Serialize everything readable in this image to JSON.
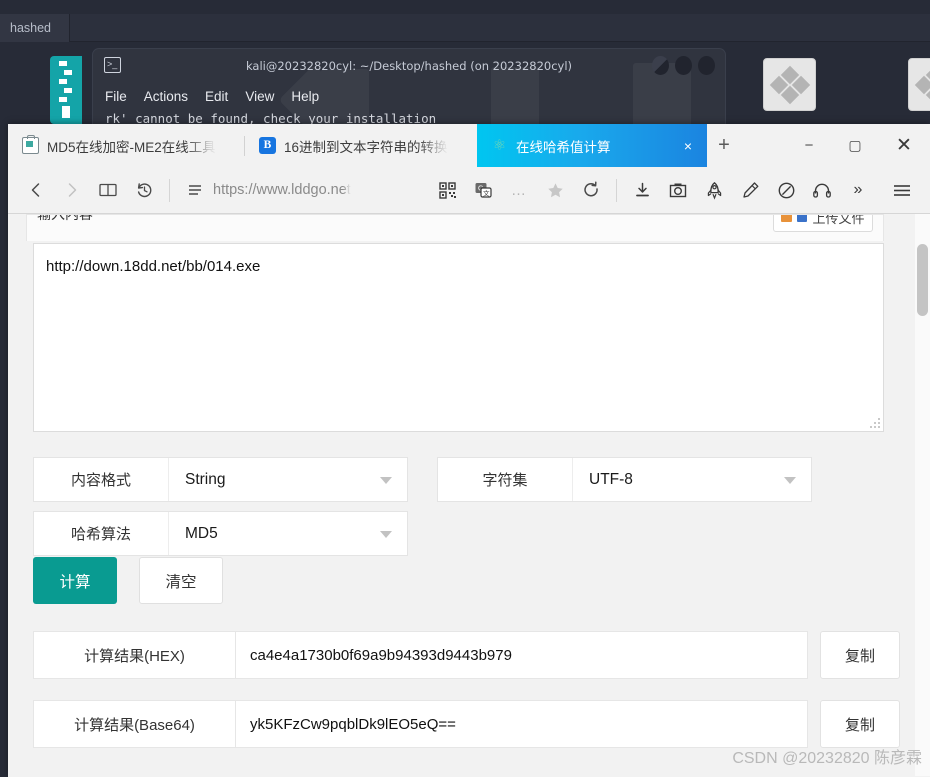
{
  "desktop": {
    "taskbar_tab": "hashed",
    "terminal": {
      "title": "kali@20232820cyl: ~/Desktop/hashed (on 20232820cyl)",
      "menu": [
        "File",
        "Actions",
        "Edit",
        "View",
        "Help"
      ],
      "output_line": "rk' cannot be found, check your installation"
    },
    "icons": [
      "desktop-icon-1",
      "desktop-icon-2"
    ]
  },
  "browser": {
    "tabs": [
      {
        "label": "MD5在线加密-ME2在线工具",
        "favicon": "md5-tool-icon",
        "active": false
      },
      {
        "label": "16进制到文本字符串的转换",
        "favicon": "b-letter-icon",
        "active": false
      },
      {
        "label": "在线哈希值计算",
        "favicon": "hash-network-icon",
        "active": true,
        "close": "×"
      }
    ],
    "new_tab_label": "+",
    "window_controls": {
      "minimize": "−",
      "maximize": "▢",
      "close": "✕"
    },
    "toolbar": {
      "back": "‹",
      "forward": "›",
      "reading_list": "book-icon",
      "history": "history-icon",
      "menu_lines": "list-icon",
      "url": "https://www.lddgo.net",
      "url_highlight": "lddgo.net",
      "qrcode": "qrcode-icon",
      "translate": "translate-icon",
      "more_dots": "…",
      "bookmark": "star-icon",
      "reload": "reload-icon",
      "download": "download-icon",
      "screenshot": "camera-icon",
      "speedup": "rocket-icon",
      "shield": "ink-icon",
      "compass": "compass-icon",
      "headphones": "headphones-icon",
      "overflow": "»",
      "hamburger": "hamburger-icon"
    }
  },
  "page": {
    "clipped_header_label": "输入内容",
    "upload_button": "上传文件",
    "textarea_value": "http://down.18dd.net/bb/014.exe",
    "fields": [
      {
        "label": "内容格式",
        "value": "String"
      },
      {
        "label": "字符集",
        "value": "UTF-8"
      },
      {
        "label": "哈希算法",
        "value": "MD5"
      }
    ],
    "buttons": {
      "calculate": "计算",
      "clear": "清空"
    },
    "results": [
      {
        "label": "计算结果(HEX)",
        "value": "ca4e4a1730b0f69a9b94393d9443b979",
        "copy": "复制"
      },
      {
        "label": "计算结果(Base64)",
        "value": "yk5KFzCw9pqblDk9lEO5eQ==",
        "copy": "复制"
      }
    ],
    "watermark": "CSDN @20232820 陈彦霖"
  },
  "colors": {
    "accent_teal": "#099b91",
    "active_tab_gradient_start": "#00c6f0",
    "active_tab_gradient_end": "#1b84e0",
    "desktop_bg": "#272b37"
  }
}
